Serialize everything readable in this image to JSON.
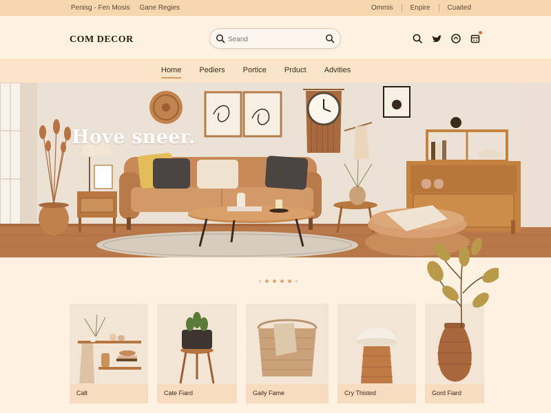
{
  "topbar": {
    "left": [
      "Penisg - Fen Mosis",
      "Gane Regies"
    ],
    "right": [
      "Ommis",
      "Enpire",
      "Cuaited"
    ]
  },
  "header": {
    "logo": "COM DECOR",
    "search_placeholder": "Seand",
    "icons": [
      "search-icon",
      "bird-icon",
      "chat-icon",
      "cart-icon"
    ]
  },
  "nav": {
    "items": [
      "Home",
      "Pediers",
      "Portice",
      "Prduct",
      "Advities"
    ],
    "active": "Home"
  },
  "hero": {
    "title": "Hove sneer."
  },
  "carousel": {
    "dots": 5,
    "active_index": 2
  },
  "products": [
    {
      "label": "Calt"
    },
    {
      "label": "Cate Fiard"
    },
    {
      "label": "Gaily Fame"
    },
    {
      "label": "Cry Thisted"
    },
    {
      "label": "Gord Fiard"
    }
  ],
  "colors": {
    "topbar": "#f6d7b0",
    "nav": "#fae4c8",
    "page": "#fdf1e2",
    "accent": "#d89a5a"
  }
}
